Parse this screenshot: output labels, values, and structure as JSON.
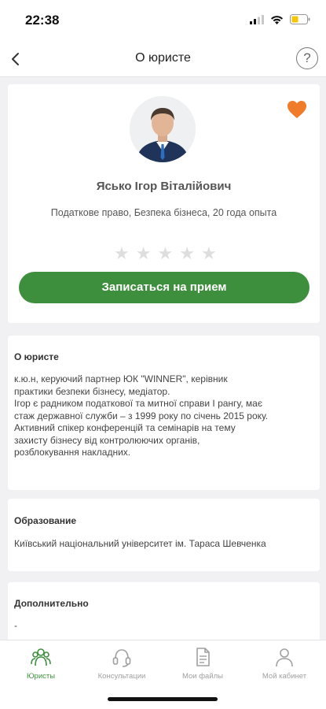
{
  "status_bar": {
    "time": "22:38"
  },
  "nav": {
    "title": "О юристе",
    "help_label": "?"
  },
  "profile": {
    "name": "Ясько Ігор Віталійович",
    "specialization": "Податкове право, Безпека бізнеса, 20 года опыта",
    "rating": 0,
    "rating_max": 5,
    "favorite": true,
    "book_label": "Записаться на прием"
  },
  "about": {
    "title": "О юристе",
    "lines": [
      "к.ю.н, керуючий партнер ЮК \"WINNER\", керівник",
      "практики безпеки бізнесу, медіатор.",
      "Ігор є радником податкової та митної справи І рангу, має",
      "стаж державної служби – з 1999 року по січень 2015 року.",
      "Активний спікер конференцій та семінарів на тему",
      "захисту бізнесу від контролюючих органів,",
      "розблокування накладних."
    ]
  },
  "education": {
    "title": "Образование",
    "text": "Київський національний університет ім. Тараса Шевченка"
  },
  "additional": {
    "title": "Дополнительно",
    "text": "-"
  },
  "tabs": [
    {
      "label": "Юристы",
      "icon": "lawyers-icon",
      "active": true
    },
    {
      "label": "Консультации",
      "icon": "consultations-icon",
      "active": false
    },
    {
      "label": "Мои файлы",
      "icon": "files-icon",
      "active": false
    },
    {
      "label": "Мой кабинет",
      "icon": "cabinet-icon",
      "active": false
    }
  ],
  "colors": {
    "accent": "#3e8f3d",
    "favorite": "#f07c2a",
    "background": "#f1f1f3"
  }
}
